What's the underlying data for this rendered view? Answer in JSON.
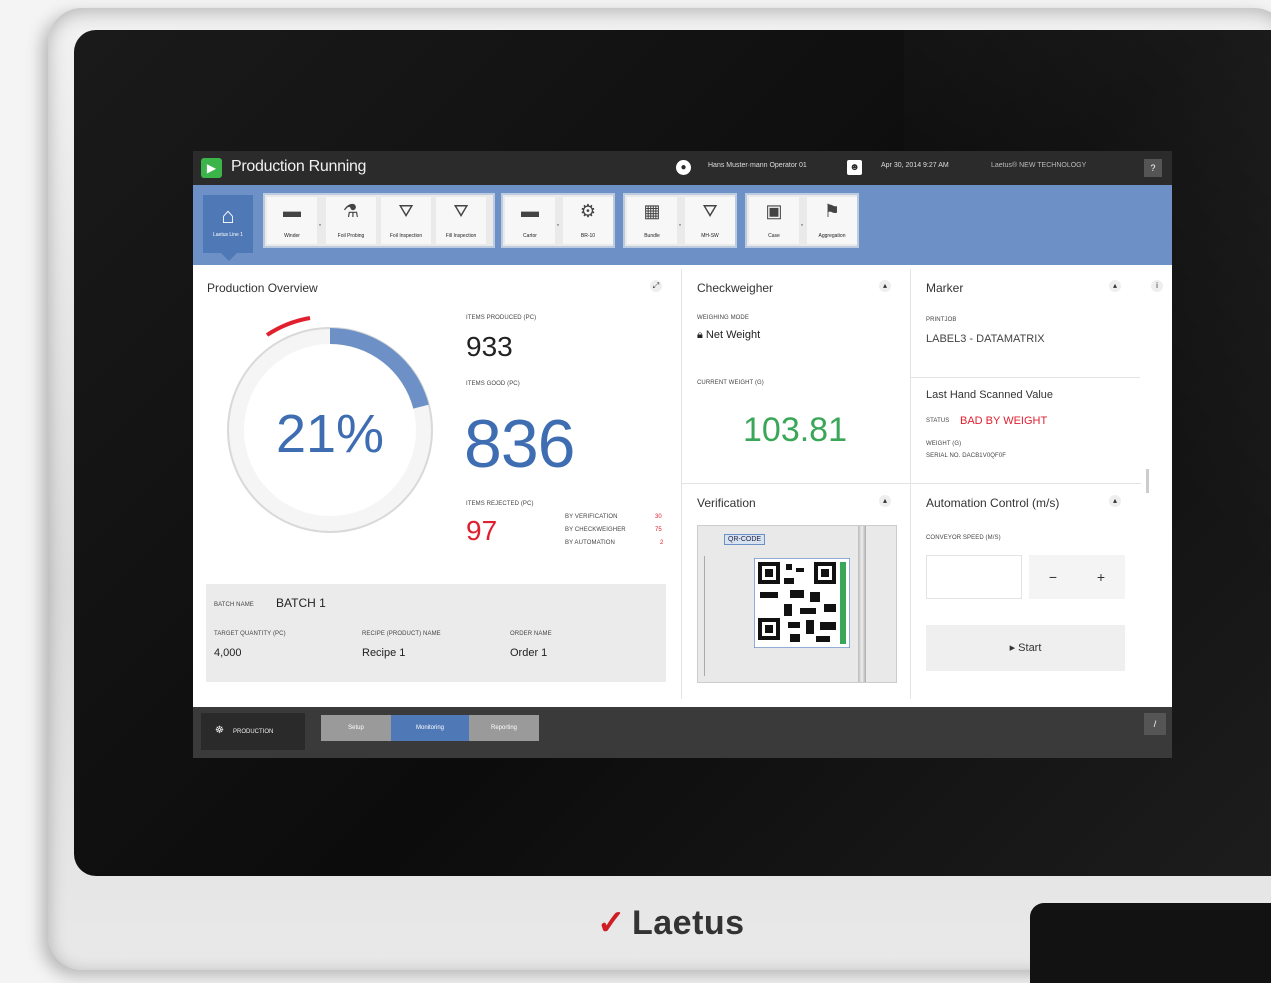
{
  "header": {
    "icon": "play-icon",
    "title": "Production Running",
    "user": "Hans Muster·mann Operator 01",
    "date": "Apr 30, 2014 9:27 AM",
    "brand": "Laetus® NEW TECHNOLOGY",
    "help": "?"
  },
  "toolbar": {
    "home_label": "Laetus Line 1",
    "groups": [
      [
        "Winder",
        "Foil Probing",
        "Foil Inspection",
        "Fill Inspection"
      ],
      [
        "Cartor",
        "BR-10"
      ],
      [
        "Bundle",
        "MH-SW"
      ],
      [
        "Case",
        "Aggregation"
      ]
    ]
  },
  "overview": {
    "title": "Production Overview",
    "percent": "21%",
    "progress_fraction": 0.21,
    "items_produced_label": "ITEMS PRODUCED (pc)",
    "items_produced": "933",
    "items_good_label": "ITEMS GOOD (pc)",
    "items_good": "836",
    "items_rejected_label": "ITEMS REJECTED (pc)",
    "items_rejected": "97",
    "reject_breakdown": [
      {
        "label": "BY VERIFICATION",
        "value": "30"
      },
      {
        "label": "BY CHECKWEIGHER",
        "value": "75"
      },
      {
        "label": "BY AUTOMATION",
        "value": "2"
      }
    ],
    "batch_name_label": "BATCH NAME",
    "batch_name": "BATCH 1",
    "target_qty_label": "TARGET QUANTITY (pc)",
    "target_qty": "4,000",
    "recipe_label": "RECIPE (PRODUCT) NAME",
    "recipe": "Recipe 1",
    "order_label": "ORDER NAME",
    "order": "Order 1"
  },
  "checkweigher": {
    "title": "Checkweigher",
    "mode_label": "WEIGHING MODE",
    "mode": "Net Weight",
    "weight_label": "CURRENT WEIGHT (G)",
    "weight": "103.81"
  },
  "marker": {
    "title": "Marker",
    "printjob_label": "PRINTJOB",
    "printjob": "LABEL3 - DATAMATRIX"
  },
  "scan": {
    "title": "Last Hand Scanned Value",
    "status_label": "STATUS",
    "status": "BAD BY WEIGHT",
    "weight_label": "WEIGHT (g)",
    "serial_label": "SERIAL NO. DACB1V0QF0F"
  },
  "verification": {
    "title": "Verification",
    "code_tag": "QR-CODE"
  },
  "automation": {
    "title": "Automation Control (m/s)",
    "speed_label": "CONVEYOR SPEED (m/s)",
    "minus": "−",
    "plus": "+",
    "start": "▸ Start"
  },
  "footer": {
    "production": "PRODUCTION",
    "steps": [
      "Setup",
      "Monitoring",
      "Reporting"
    ],
    "edit": "/"
  },
  "brand": "Laetus",
  "colors": {
    "accent": "#6d91c6",
    "good": "#3aa657",
    "bad": "#e0202e"
  }
}
